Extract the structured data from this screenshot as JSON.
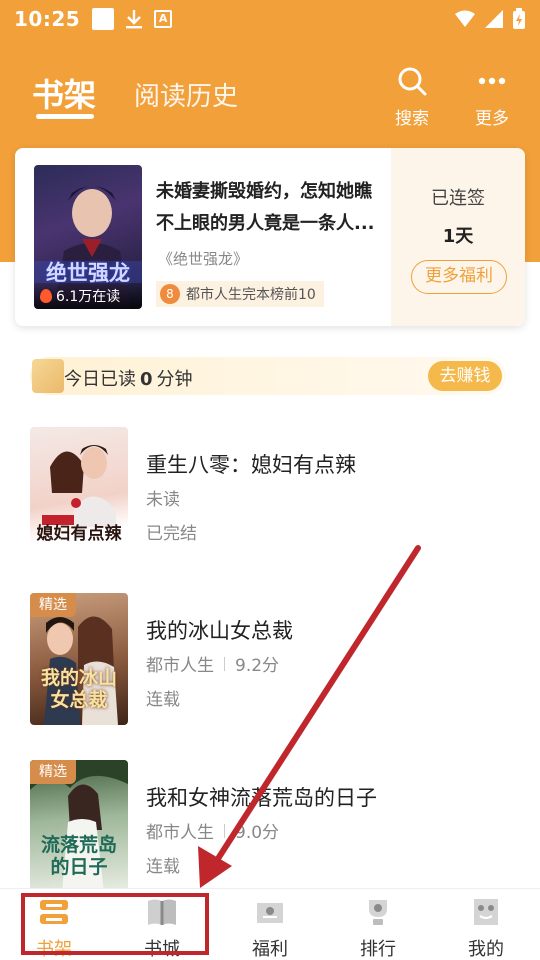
{
  "status_bar": {
    "time": "10:25",
    "a_icon_letter": "A"
  },
  "header": {
    "tab_active": "书架",
    "tab_inactive": "阅读历史",
    "search_label": "搜索",
    "more_label": "更多"
  },
  "featured": {
    "title": "未婚妻撕毁婚约，怎知她瞧不上眼的男人竟是一条人...",
    "series": "《绝世强龙》",
    "cover_title": "绝世强龙",
    "readers": "6.1万在读",
    "rank": "都市人生完本榜前10",
    "signed_label": "已连签",
    "signed_days": "1天",
    "welfare_button": "更多福利"
  },
  "reading_bar": {
    "prefix": "今日已读",
    "minutes": "0",
    "suffix": "分钟",
    "earn_button": "去赚钱"
  },
  "books": [
    {
      "title": "重生八零：媳妇有点辣",
      "meta1": "未读",
      "meta2": "",
      "status": "已完结",
      "tag": "",
      "cover_text": "媳妇有点辣"
    },
    {
      "title": "我的冰山女总裁",
      "meta1": "都市人生",
      "meta2": "9.2分",
      "status": "连载",
      "tag": "精选",
      "cover_text": "我的冰山女总裁"
    },
    {
      "title": "我和女神流落荒岛的日子",
      "meta1": "都市人生",
      "meta2": "9.0分",
      "status": "连载",
      "tag": "精选",
      "cover_text": "流落荒岛的日子"
    }
  ],
  "bottom_nav": {
    "items": [
      {
        "label": "书架",
        "icon": "bookshelf-icon",
        "active": true
      },
      {
        "label": "书城",
        "icon": "book-icon",
        "active": false
      },
      {
        "label": "福利",
        "icon": "gift-icon",
        "active": false
      },
      {
        "label": "排行",
        "icon": "trophy-icon",
        "active": false
      },
      {
        "label": "我的",
        "icon": "profile-icon",
        "active": false
      }
    ]
  },
  "colors": {
    "brand": "#f2a03a",
    "annotation_red": "#c0272d",
    "active_tab": "#f2a03a"
  }
}
